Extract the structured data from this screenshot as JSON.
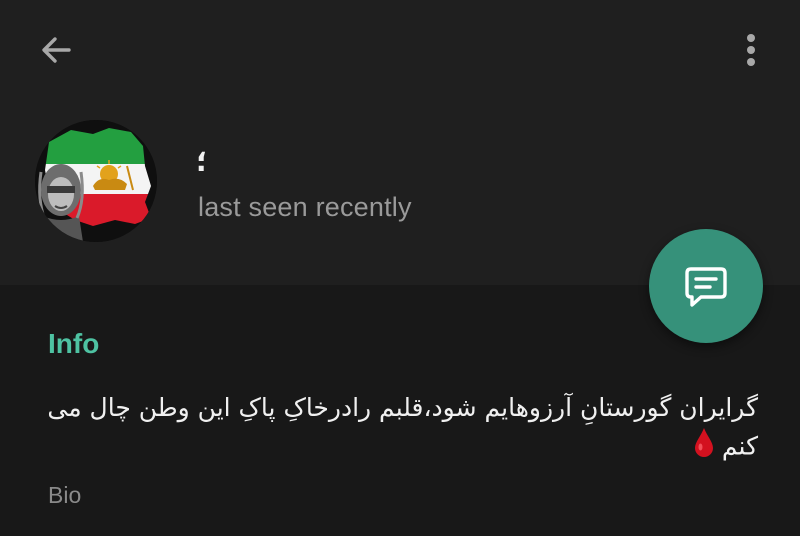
{
  "header": {
    "back_icon": "arrow-left-icon",
    "more_icon": "more-vertical-icon",
    "name": "؛",
    "status": "last seen recently",
    "avatar_icon": "iranian-lion-sun-flag-avatar",
    "message_icon": "message-icon"
  },
  "info": {
    "title": "Info",
    "bio": "گرایران گورستانِ آرزوهایم شود،قلبم رادرخاکِ پاکِ این وطن چال می کنم",
    "bio_emoji": "drop-of-blood-icon",
    "bio_label": "Bio"
  },
  "colors": {
    "accent": "#4ec2a2",
    "fab": "#36917a",
    "background": "#1e1e1e",
    "muted_text": "#9a9a9a"
  }
}
